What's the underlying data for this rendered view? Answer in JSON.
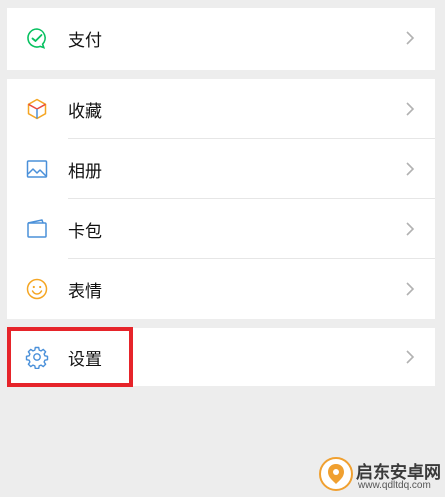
{
  "menu": {
    "pay": {
      "label": "支付",
      "icon": "pay-icon"
    },
    "favorites": {
      "label": "收藏",
      "icon": "favorites-cube-icon"
    },
    "album": {
      "label": "相册",
      "icon": "album-image-icon"
    },
    "cards": {
      "label": "卡包",
      "icon": "card-wallet-icon"
    },
    "stickers": {
      "label": "表情",
      "icon": "smiley-icon"
    },
    "settings": {
      "label": "设置",
      "icon": "gear-icon"
    }
  },
  "annotation": {
    "highlight_color": "#e6242a"
  },
  "watermark": {
    "text": "启东安卓网",
    "url": "www.qdltdq.com"
  },
  "colors": {
    "pay_green": "#07c160",
    "icon_blue": "#4a90d9",
    "smile_orange": "#f5a623",
    "background": "#ededed"
  }
}
